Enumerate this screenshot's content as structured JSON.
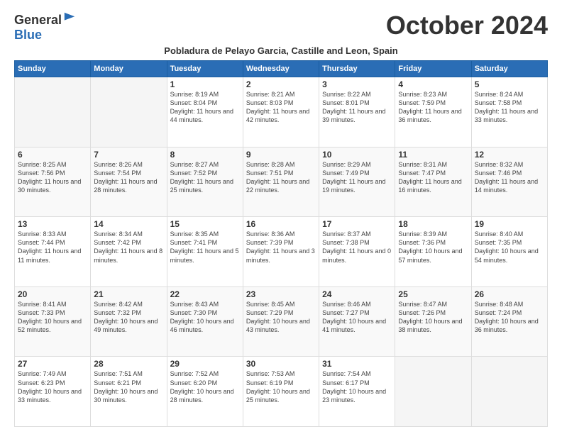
{
  "header": {
    "logo": {
      "general": "General",
      "blue": "Blue",
      "tagline": ""
    },
    "title": "October 2024",
    "subtitle": "Pobladura de Pelayo Garcia, Castille and Leon, Spain"
  },
  "days_of_week": [
    "Sunday",
    "Monday",
    "Tuesday",
    "Wednesday",
    "Thursday",
    "Friday",
    "Saturday"
  ],
  "weeks": [
    [
      {
        "day": null
      },
      {
        "day": null
      },
      {
        "day": "1",
        "sunrise": "Sunrise: 8:19 AM",
        "sunset": "Sunset: 8:04 PM",
        "daylight": "Daylight: 11 hours and 44 minutes."
      },
      {
        "day": "2",
        "sunrise": "Sunrise: 8:21 AM",
        "sunset": "Sunset: 8:03 PM",
        "daylight": "Daylight: 11 hours and 42 minutes."
      },
      {
        "day": "3",
        "sunrise": "Sunrise: 8:22 AM",
        "sunset": "Sunset: 8:01 PM",
        "daylight": "Daylight: 11 hours and 39 minutes."
      },
      {
        "day": "4",
        "sunrise": "Sunrise: 8:23 AM",
        "sunset": "Sunset: 7:59 PM",
        "daylight": "Daylight: 11 hours and 36 minutes."
      },
      {
        "day": "5",
        "sunrise": "Sunrise: 8:24 AM",
        "sunset": "Sunset: 7:58 PM",
        "daylight": "Daylight: 11 hours and 33 minutes."
      }
    ],
    [
      {
        "day": "6",
        "sunrise": "Sunrise: 8:25 AM",
        "sunset": "Sunset: 7:56 PM",
        "daylight": "Daylight: 11 hours and 30 minutes."
      },
      {
        "day": "7",
        "sunrise": "Sunrise: 8:26 AM",
        "sunset": "Sunset: 7:54 PM",
        "daylight": "Daylight: 11 hours and 28 minutes."
      },
      {
        "day": "8",
        "sunrise": "Sunrise: 8:27 AM",
        "sunset": "Sunset: 7:52 PM",
        "daylight": "Daylight: 11 hours and 25 minutes."
      },
      {
        "day": "9",
        "sunrise": "Sunrise: 8:28 AM",
        "sunset": "Sunset: 7:51 PM",
        "daylight": "Daylight: 11 hours and 22 minutes."
      },
      {
        "day": "10",
        "sunrise": "Sunrise: 8:29 AM",
        "sunset": "Sunset: 7:49 PM",
        "daylight": "Daylight: 11 hours and 19 minutes."
      },
      {
        "day": "11",
        "sunrise": "Sunrise: 8:31 AM",
        "sunset": "Sunset: 7:47 PM",
        "daylight": "Daylight: 11 hours and 16 minutes."
      },
      {
        "day": "12",
        "sunrise": "Sunrise: 8:32 AM",
        "sunset": "Sunset: 7:46 PM",
        "daylight": "Daylight: 11 hours and 14 minutes."
      }
    ],
    [
      {
        "day": "13",
        "sunrise": "Sunrise: 8:33 AM",
        "sunset": "Sunset: 7:44 PM",
        "daylight": "Daylight: 11 hours and 11 minutes."
      },
      {
        "day": "14",
        "sunrise": "Sunrise: 8:34 AM",
        "sunset": "Sunset: 7:42 PM",
        "daylight": "Daylight: 11 hours and 8 minutes."
      },
      {
        "day": "15",
        "sunrise": "Sunrise: 8:35 AM",
        "sunset": "Sunset: 7:41 PM",
        "daylight": "Daylight: 11 hours and 5 minutes."
      },
      {
        "day": "16",
        "sunrise": "Sunrise: 8:36 AM",
        "sunset": "Sunset: 7:39 PM",
        "daylight": "Daylight: 11 hours and 3 minutes."
      },
      {
        "day": "17",
        "sunrise": "Sunrise: 8:37 AM",
        "sunset": "Sunset: 7:38 PM",
        "daylight": "Daylight: 11 hours and 0 minutes."
      },
      {
        "day": "18",
        "sunrise": "Sunrise: 8:39 AM",
        "sunset": "Sunset: 7:36 PM",
        "daylight": "Daylight: 10 hours and 57 minutes."
      },
      {
        "day": "19",
        "sunrise": "Sunrise: 8:40 AM",
        "sunset": "Sunset: 7:35 PM",
        "daylight": "Daylight: 10 hours and 54 minutes."
      }
    ],
    [
      {
        "day": "20",
        "sunrise": "Sunrise: 8:41 AM",
        "sunset": "Sunset: 7:33 PM",
        "daylight": "Daylight: 10 hours and 52 minutes."
      },
      {
        "day": "21",
        "sunrise": "Sunrise: 8:42 AM",
        "sunset": "Sunset: 7:32 PM",
        "daylight": "Daylight: 10 hours and 49 minutes."
      },
      {
        "day": "22",
        "sunrise": "Sunrise: 8:43 AM",
        "sunset": "Sunset: 7:30 PM",
        "daylight": "Daylight: 10 hours and 46 minutes."
      },
      {
        "day": "23",
        "sunrise": "Sunrise: 8:45 AM",
        "sunset": "Sunset: 7:29 PM",
        "daylight": "Daylight: 10 hours and 43 minutes."
      },
      {
        "day": "24",
        "sunrise": "Sunrise: 8:46 AM",
        "sunset": "Sunset: 7:27 PM",
        "daylight": "Daylight: 10 hours and 41 minutes."
      },
      {
        "day": "25",
        "sunrise": "Sunrise: 8:47 AM",
        "sunset": "Sunset: 7:26 PM",
        "daylight": "Daylight: 10 hours and 38 minutes."
      },
      {
        "day": "26",
        "sunrise": "Sunrise: 8:48 AM",
        "sunset": "Sunset: 7:24 PM",
        "daylight": "Daylight: 10 hours and 36 minutes."
      }
    ],
    [
      {
        "day": "27",
        "sunrise": "Sunrise: 7:49 AM",
        "sunset": "Sunset: 6:23 PM",
        "daylight": "Daylight: 10 hours and 33 minutes."
      },
      {
        "day": "28",
        "sunrise": "Sunrise: 7:51 AM",
        "sunset": "Sunset: 6:21 PM",
        "daylight": "Daylight: 10 hours and 30 minutes."
      },
      {
        "day": "29",
        "sunrise": "Sunrise: 7:52 AM",
        "sunset": "Sunset: 6:20 PM",
        "daylight": "Daylight: 10 hours and 28 minutes."
      },
      {
        "day": "30",
        "sunrise": "Sunrise: 7:53 AM",
        "sunset": "Sunset: 6:19 PM",
        "daylight": "Daylight: 10 hours and 25 minutes."
      },
      {
        "day": "31",
        "sunrise": "Sunrise: 7:54 AM",
        "sunset": "Sunset: 6:17 PM",
        "daylight": "Daylight: 10 hours and 23 minutes."
      },
      {
        "day": null
      },
      {
        "day": null
      }
    ]
  ]
}
